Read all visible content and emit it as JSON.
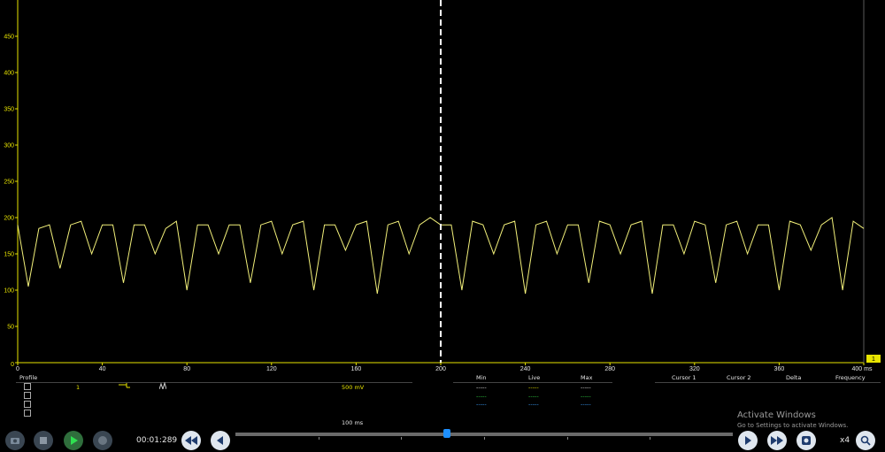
{
  "y_ticks": [
    "0",
    "50",
    "100",
    "150",
    "200",
    "250",
    "300",
    "350",
    "400",
    "450"
  ],
  "x_ticks": [
    "0",
    "40",
    "80",
    "120",
    "160",
    "200",
    "240",
    "280",
    "320",
    "360",
    "400 ms"
  ],
  "channel_marker": "1",
  "profile_label": "Profile",
  "channel": {
    "number": "1",
    "scale": "500 mV"
  },
  "timebase": "100 ms",
  "measure_headers": {
    "min": "Min",
    "live": "Live",
    "max": "Max"
  },
  "cursor_headers": {
    "cursor1": "Cursor 1",
    "cursor2": "Cursor 2",
    "delta": "Delta",
    "frequency": "Frequency"
  },
  "measure_rows": [
    {
      "min": "-----",
      "live": "-----",
      "max": "-----"
    },
    {
      "min": "-----",
      "live": "-----",
      "max": "-----"
    },
    {
      "min": "-----",
      "live": "-----",
      "max": "-----"
    }
  ],
  "playback": {
    "time": "00:01:289",
    "speed": "x4",
    "position": 0.425
  },
  "watermark": {
    "title": "Activate Windows",
    "subtitle": "Go to Settings to activate Windows."
  },
  "colors": {
    "trace": "#f2f07a",
    "axis": "#e8e400",
    "live1": "#e8e400",
    "live2": "#2ecc40",
    "live3": "#3aa0ff",
    "slider": "#1e90ff"
  },
  "chart_data": {
    "type": "line",
    "xlabel": "ms",
    "xlim": [
      0,
      400
    ],
    "ylim": [
      0,
      500
    ],
    "cursor_x": 200,
    "x": [
      0,
      5,
      10,
      15,
      20,
      25,
      30,
      35,
      40,
      45,
      50,
      55,
      60,
      65,
      70,
      75,
      80,
      85,
      90,
      95,
      100,
      105,
      110,
      115,
      120,
      125,
      130,
      135,
      140,
      145,
      150,
      155,
      160,
      165,
      170,
      175,
      180,
      185,
      190,
      195,
      200,
      205,
      210,
      215,
      220,
      225,
      230,
      235,
      240,
      245,
      250,
      255,
      260,
      265,
      270,
      275,
      280,
      285,
      290,
      295,
      300,
      305,
      310,
      315,
      320,
      325,
      330,
      335,
      340,
      345,
      350,
      355,
      360,
      365,
      370,
      375,
      380,
      385,
      390,
      395,
      400
    ],
    "y": [
      190,
      105,
      185,
      190,
      130,
      190,
      195,
      150,
      190,
      190,
      110,
      190,
      190,
      150,
      185,
      195,
      100,
      190,
      190,
      150,
      190,
      190,
      110,
      190,
      195,
      150,
      190,
      195,
      100,
      190,
      190,
      155,
      190,
      195,
      95,
      190,
      195,
      150,
      190,
      200,
      190,
      190,
      100,
      195,
      190,
      150,
      190,
      195,
      95,
      190,
      195,
      150,
      190,
      190,
      110,
      195,
      190,
      150,
      190,
      195,
      95,
      190,
      190,
      150,
      195,
      190,
      110,
      190,
      195,
      150,
      190,
      190,
      100,
      195,
      190,
      155,
      190,
      200,
      100,
      195,
      185
    ]
  }
}
